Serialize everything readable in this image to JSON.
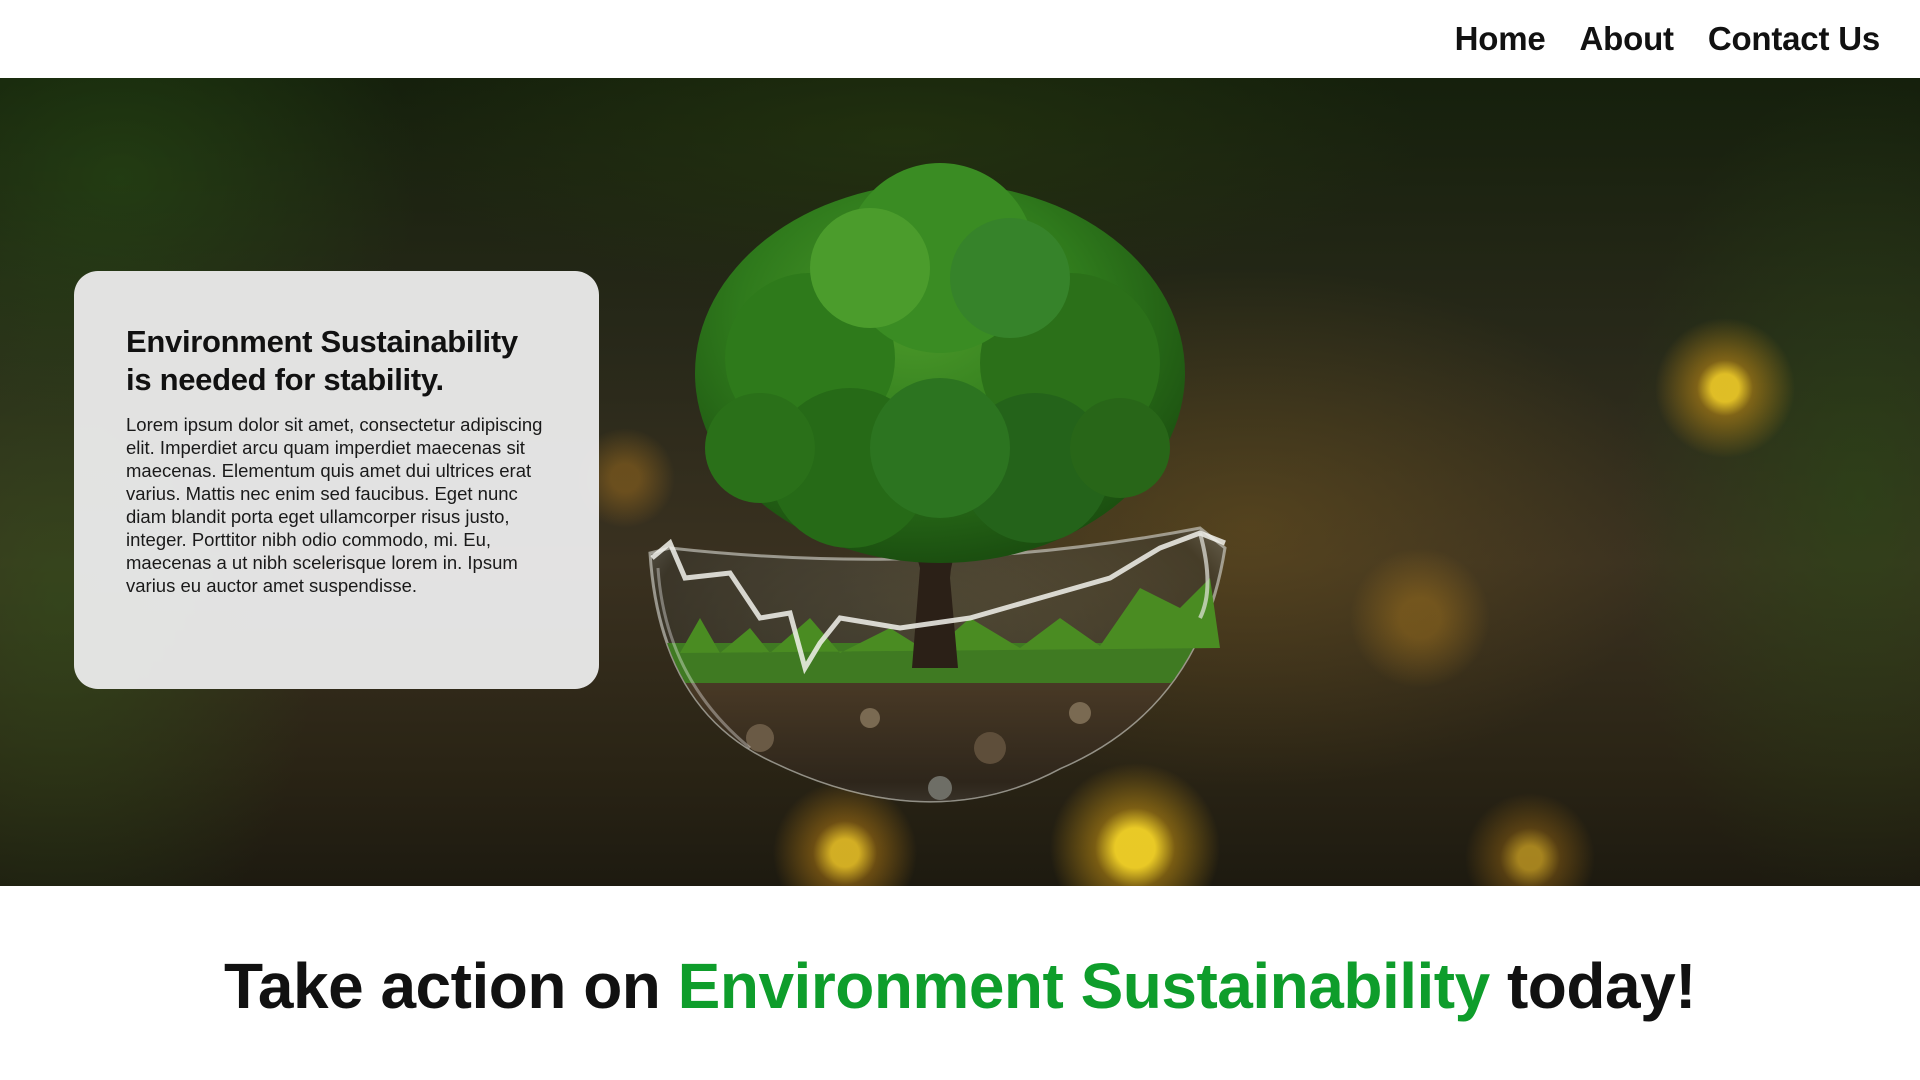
{
  "nav": {
    "links": [
      "Home",
      "About",
      "Contact Us"
    ]
  },
  "hero": {
    "image_name": "tree-in-glass-sphere",
    "card": {
      "title_line1": "Environment Sustainability",
      "title_line2": "is needed for stability.",
      "body": "Lorem ipsum dolor sit amet, consectetur adipiscing elit. Imperdiet arcu quam imperdiet maecenas sit maecenas. Elementum quis amet dui ultrices erat varius. Mattis nec enim sed faucibus. Eget nunc diam blandit porta eget ullamcorper risus justo, integer. Porttitor nibh odio commodo, mi. Eu, maecenas a ut nibh scelerisque lorem in. Ipsum varius eu auctor amet suspendisse."
    }
  },
  "headline": {
    "prefix": "Take action on",
    "accent": "Environment Sustainability",
    "suffix": "today!"
  },
  "colors": {
    "accent": "#0e9d2b",
    "text": "#111111",
    "card_bg": "#e8e8e8"
  }
}
